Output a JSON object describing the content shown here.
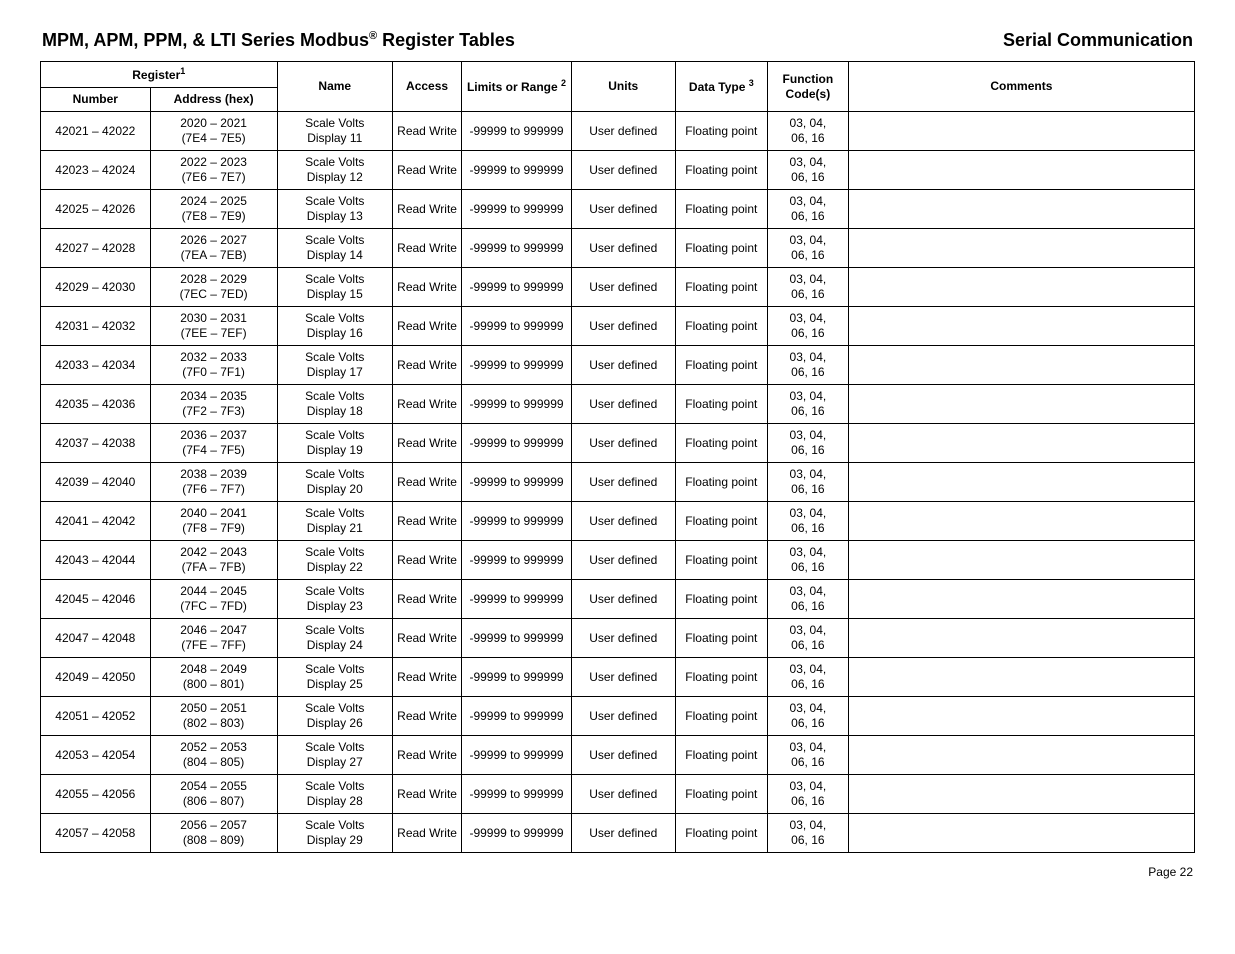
{
  "header": {
    "title_left": "MPM, APM, PPM, & LTI Series Modbus",
    "title_left_suffix": " Register Tables",
    "registered": "®",
    "title_right": "Serial Communication"
  },
  "table": {
    "head": {
      "register": "Register",
      "register_fn": "1",
      "number": "Number",
      "address": "Address (hex)",
      "name": "Name",
      "access": "Access",
      "limits": "Limits or Range",
      "limits_fn": "2",
      "units": "Units",
      "data_type": "Data Type",
      "data_type_fn": "3",
      "function_codes": "Function Code(s)",
      "comments": "Comments"
    },
    "rows": [
      {
        "number": "42021 – 42022",
        "addr_l1": "2020 – 2021",
        "addr_l2": "(7E4 – 7E5)",
        "name_l1": "Scale Volts",
        "name_l2": "Display 11",
        "access": "Read Write",
        "limits": "-99999 to 999999",
        "units": "User defined",
        "dtype": "Floating point",
        "fcode_l1": "03, 04,",
        "fcode_l2": "06, 16",
        "comments": ""
      },
      {
        "number": "42023 – 42024",
        "addr_l1": "2022 – 2023",
        "addr_l2": "(7E6 – 7E7)",
        "name_l1": "Scale Volts",
        "name_l2": "Display 12",
        "access": "Read Write",
        "limits": "-99999 to 999999",
        "units": "User defined",
        "dtype": "Floating point",
        "fcode_l1": "03, 04,",
        "fcode_l2": "06, 16",
        "comments": ""
      },
      {
        "number": "42025 – 42026",
        "addr_l1": "2024 – 2025",
        "addr_l2": "(7E8 – 7E9)",
        "name_l1": "Scale Volts",
        "name_l2": "Display 13",
        "access": "Read Write",
        "limits": "-99999 to 999999",
        "units": "User defined",
        "dtype": "Floating point",
        "fcode_l1": "03, 04,",
        "fcode_l2": "06, 16",
        "comments": ""
      },
      {
        "number": "42027 –  42028",
        "addr_l1": "2026 – 2027",
        "addr_l2": "(7EA – 7EB)",
        "name_l1": "Scale Volts",
        "name_l2": "Display 14",
        "access": "Read Write",
        "limits": "-99999 to 999999",
        "units": "User defined",
        "dtype": "Floating point",
        "fcode_l1": "03, 04,",
        "fcode_l2": "06, 16",
        "comments": ""
      },
      {
        "number": "42029 – 42030",
        "addr_l1": "2028 – 2029",
        "addr_l2": "(7EC – 7ED)",
        "name_l1": "Scale Volts",
        "name_l2": "Display 15",
        "access": "Read Write",
        "limits": "-99999 to 999999",
        "units": "User defined",
        "dtype": "Floating point",
        "fcode_l1": "03, 04,",
        "fcode_l2": "06, 16",
        "comments": ""
      },
      {
        "number": "42031 – 42032",
        "addr_l1": "2030 – 2031",
        "addr_l2": "(7EE – 7EF)",
        "name_l1": "Scale Volts",
        "name_l2": "Display 16",
        "access": "Read Write",
        "limits": "-99999 to 999999",
        "units": "User defined",
        "dtype": "Floating point",
        "fcode_l1": "03, 04,",
        "fcode_l2": "06, 16",
        "comments": ""
      },
      {
        "number": "42033 – 42034",
        "addr_l1": "2032 – 2033",
        "addr_l2": "(7F0 – 7F1)",
        "name_l1": "Scale Volts",
        "name_l2": "Display 17",
        "access": "Read Write",
        "limits": "-99999 to 999999",
        "units": "User defined",
        "dtype": "Floating point",
        "fcode_l1": "03, 04,",
        "fcode_l2": "06, 16",
        "comments": ""
      },
      {
        "number": "42035 – 42036",
        "addr_l1": "2034 – 2035",
        "addr_l2": "(7F2 – 7F3)",
        "name_l1": "Scale Volts",
        "name_l2": "Display 18",
        "access": "Read Write",
        "limits": "-99999 to 999999",
        "units": "User defined",
        "dtype": "Floating point",
        "fcode_l1": "03, 04,",
        "fcode_l2": "06, 16",
        "comments": ""
      },
      {
        "number": "42037 – 42038",
        "addr_l1": "2036 – 2037",
        "addr_l2": "(7F4 – 7F5)",
        "name_l1": "Scale Volts",
        "name_l2": "Display 19",
        "access": "Read Write",
        "limits": "-99999 to 999999",
        "units": "User defined",
        "dtype": "Floating point",
        "fcode_l1": "03, 04,",
        "fcode_l2": "06, 16",
        "comments": ""
      },
      {
        "number": "42039 – 42040",
        "addr_l1": "2038 – 2039",
        "addr_l2": "(7F6 – 7F7)",
        "name_l1": "Scale Volts",
        "name_l2": "Display 20",
        "access": "Read Write",
        "limits": "-99999 to 999999",
        "units": "User defined",
        "dtype": "Floating point",
        "fcode_l1": "03, 04,",
        "fcode_l2": "06, 16",
        "comments": ""
      },
      {
        "number": "42041 – 42042",
        "addr_l1": "2040 – 2041",
        "addr_l2": "(7F8 – 7F9)",
        "name_l1": "Scale Volts",
        "name_l2": "Display 21",
        "access": "Read Write",
        "limits": "-99999 to 999999",
        "units": "User defined",
        "dtype": "Floating point",
        "fcode_l1": "03, 04,",
        "fcode_l2": "06, 16",
        "comments": ""
      },
      {
        "number": "42043 – 42044",
        "addr_l1": "2042 – 2043",
        "addr_l2": "(7FA – 7FB)",
        "name_l1": "Scale Volts",
        "name_l2": "Display 22",
        "access": "Read Write",
        "limits": "-99999 to 999999",
        "units": "User defined",
        "dtype": "Floating point",
        "fcode_l1": "03, 04,",
        "fcode_l2": "06, 16",
        "comments": ""
      },
      {
        "number": "42045 – 42046",
        "addr_l1": "2044 – 2045",
        "addr_l2": "(7FC – 7FD)",
        "name_l1": "Scale Volts",
        "name_l2": "Display 23",
        "access": "Read Write",
        "limits": "-99999 to 999999",
        "units": "User defined",
        "dtype": "Floating point",
        "fcode_l1": "03, 04,",
        "fcode_l2": "06, 16",
        "comments": ""
      },
      {
        "number": "42047 – 42048",
        "addr_l1": "2046 – 2047",
        "addr_l2": "(7FE – 7FF)",
        "name_l1": "Scale Volts",
        "name_l2": "Display 24",
        "access": "Read Write",
        "limits": "-99999 to 999999",
        "units": "User defined",
        "dtype": "Floating point",
        "fcode_l1": "03, 04,",
        "fcode_l2": "06, 16",
        "comments": ""
      },
      {
        "number": "42049 – 42050",
        "addr_l1": "2048 – 2049",
        "addr_l2": "(800 – 801)",
        "name_l1": "Scale Volts",
        "name_l2": "Display 25",
        "access": "Read Write",
        "limits": "-99999 to 999999",
        "units": "User defined",
        "dtype": "Floating point",
        "fcode_l1": "03, 04,",
        "fcode_l2": "06, 16",
        "comments": ""
      },
      {
        "number": "42051 – 42052",
        "addr_l1": "2050 – 2051",
        "addr_l2": "(802 – 803)",
        "name_l1": "Scale Volts",
        "name_l2": "Display 26",
        "access": "Read Write",
        "limits": "-99999 to 999999",
        "units": "User defined",
        "dtype": "Floating point",
        "fcode_l1": "03, 04,",
        "fcode_l2": "06, 16",
        "comments": ""
      },
      {
        "number": "42053 – 42054",
        "addr_l1": "2052 – 2053",
        "addr_l2": "(804 – 805)",
        "name_l1": "Scale Volts",
        "name_l2": "Display 27",
        "access": "Read Write",
        "limits": "-99999 to 999999",
        "units": "User defined",
        "dtype": "Floating point",
        "fcode_l1": "03, 04,",
        "fcode_l2": "06, 16",
        "comments": ""
      },
      {
        "number": "42055 – 42056",
        "addr_l1": "2054 – 2055",
        "addr_l2": "(806 – 807)",
        "name_l1": "Scale Volts",
        "name_l2": "Display 28",
        "access": "Read Write",
        "limits": "-99999 to 999999",
        "units": "User defined",
        "dtype": "Floating point",
        "fcode_l1": "03, 04,",
        "fcode_l2": "06, 16",
        "comments": ""
      },
      {
        "number": "42057 – 42058",
        "addr_l1": "2056 – 2057",
        "addr_l2": "(808 – 809)",
        "name_l1": "Scale Volts",
        "name_l2": "Display 29",
        "access": "Read Write",
        "limits": "-99999 to 999999",
        "units": "User defined",
        "dtype": "Floating point",
        "fcode_l1": "03, 04,",
        "fcode_l2": "06, 16",
        "comments": ""
      }
    ]
  },
  "footer": {
    "page": "Page 22"
  }
}
